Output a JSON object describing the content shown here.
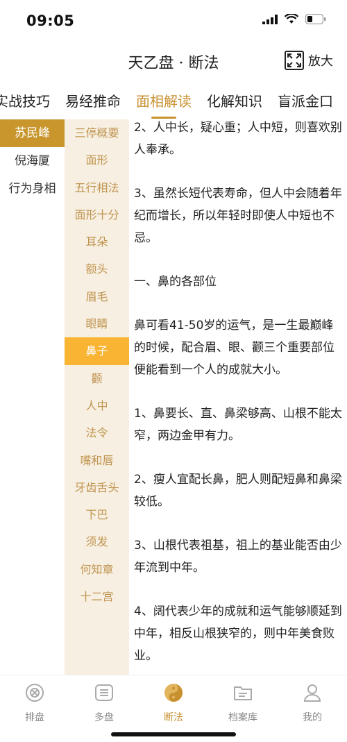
{
  "status": {
    "time": "09:05"
  },
  "header": {
    "title": "天乙盘 · 断法",
    "expand_label": "放大"
  },
  "tabs": [
    {
      "label": "实战技巧"
    },
    {
      "label": "易经推命"
    },
    {
      "label": "面相解读"
    },
    {
      "label": "化解知识"
    },
    {
      "label": "盲派金口"
    }
  ],
  "authors": [
    {
      "label": "苏民峰"
    },
    {
      "label": "倪海厦"
    },
    {
      "label": "行为身相"
    }
  ],
  "topics": [
    {
      "label": "三停概要"
    },
    {
      "label": "面形"
    },
    {
      "label": "五行相法"
    },
    {
      "label": "面形十分"
    },
    {
      "label": "耳朵"
    },
    {
      "label": "额头"
    },
    {
      "label": "眉毛"
    },
    {
      "label": "眼睛"
    },
    {
      "label": "鼻子"
    },
    {
      "label": "颧"
    },
    {
      "label": "人中"
    },
    {
      "label": "法令"
    },
    {
      "label": "嘴和唇"
    },
    {
      "label": "牙齿舌头"
    },
    {
      "label": "下巴"
    },
    {
      "label": "须发"
    },
    {
      "label": "何知章"
    },
    {
      "label": "十二宫"
    }
  ],
  "content": [
    "2、人中长，疑心重；人中短，则喜欢别人奉承。",
    "3、虽然长短代表寿命，但人中会随着年纪而增长，所以年轻时即使人中短也不忌。",
    "一、鼻的各部位",
    "鼻可看41-50岁的运气，是一生最巅峰的时候，配合眉、眼、颧三个重要部位便能看到一个人的成就大小。",
    "1、鼻要长、直、鼻梁够高、山根不能太窄，两边金甲有力。",
    "2、瘦人宜配长鼻，肥人则配短鼻和鼻梁较低。",
    "3、山根代表祖基，祖上的基业能否由少年流到中年。",
    "4、阔代表少年的成就和运气能够顺延到中年，相反山根狭窄的，则中年美食败业。"
  ],
  "bottom_nav": [
    {
      "label": "排盘",
      "icon": "compass-icon"
    },
    {
      "label": "多盘",
      "icon": "stack-icon"
    },
    {
      "label": "断法",
      "icon": "yinyang-icon"
    },
    {
      "label": "档案库",
      "icon": "folder-icon"
    },
    {
      "label": "我的",
      "icon": "user-icon"
    }
  ],
  "colors": {
    "accent": "#c8902f",
    "author_active": "#c8962d",
    "topic_active": "#f8b432",
    "topic_bg": "#f7efe1"
  }
}
